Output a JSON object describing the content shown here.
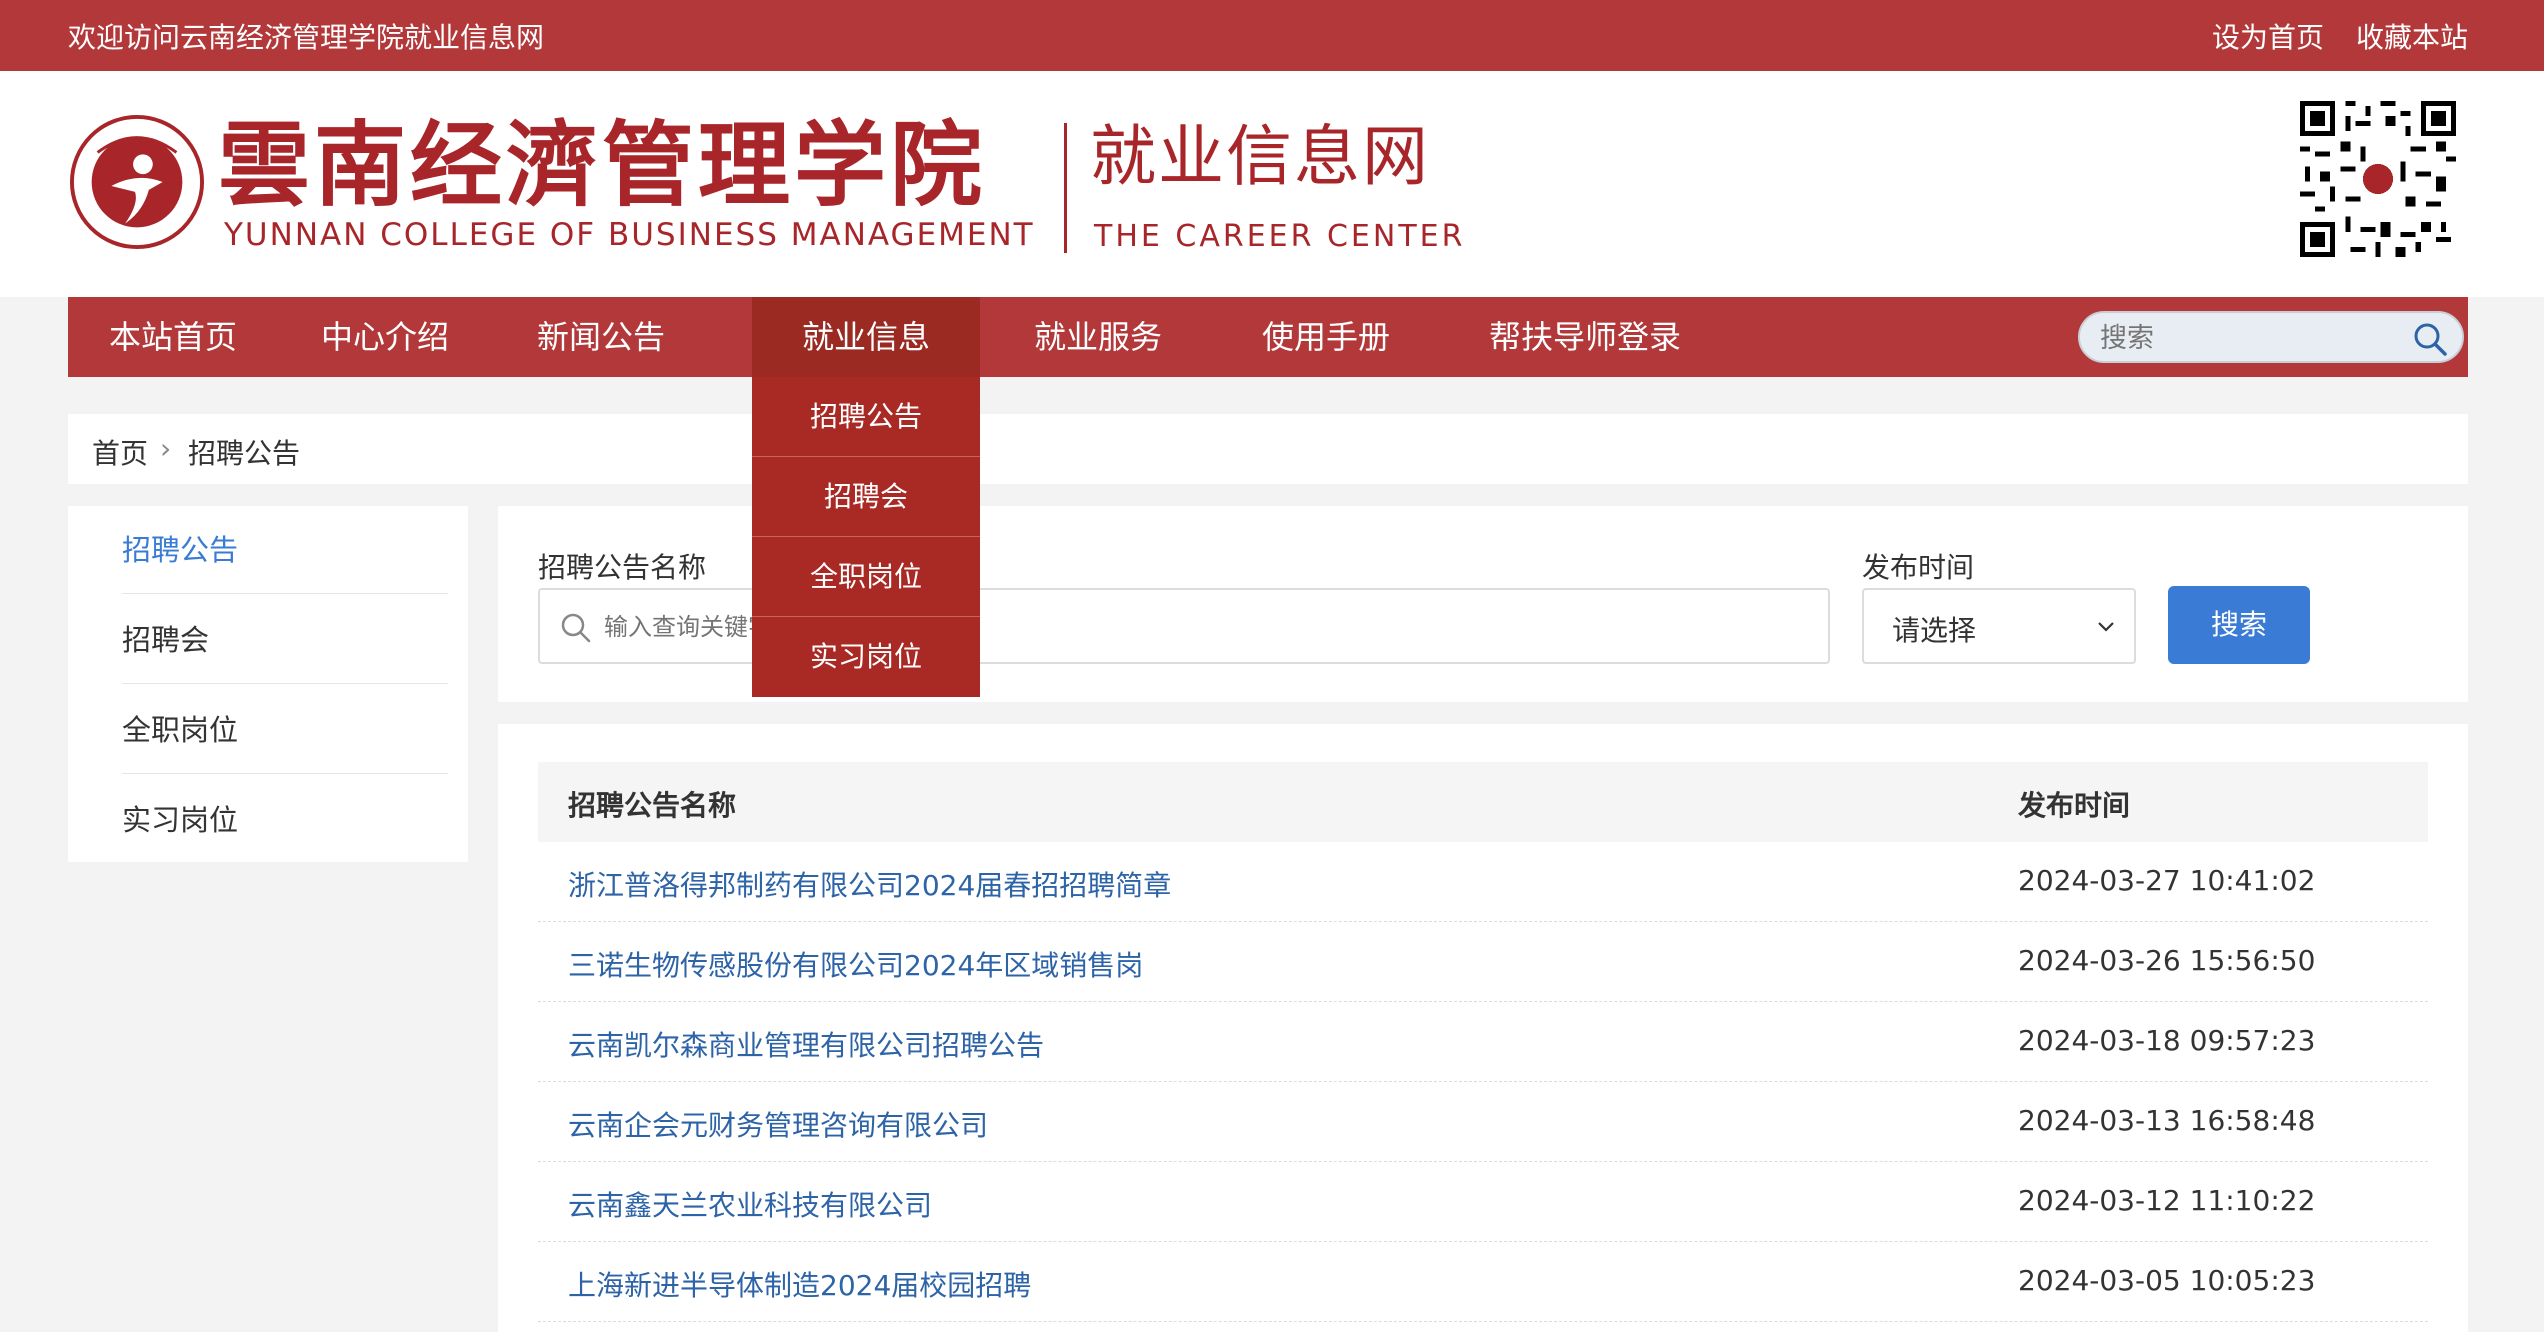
{
  "topbar": {
    "welcome": "欢迎访问云南经济管理学院就业信息网",
    "set_home": "设为首页",
    "bookmark": "收藏本站"
  },
  "header": {
    "college_cn": "雲南经濟管理学院",
    "college_en": "YUNNAN COLLEGE OF BUSINESS MANAGEMENT",
    "site_cn": "就业信息网",
    "site_en": "THE CAREER CENTER"
  },
  "nav": {
    "items": [
      {
        "label": "本站首页"
      },
      {
        "label": "中心介绍"
      },
      {
        "label": "新闻公告"
      },
      {
        "label": "就业信息"
      },
      {
        "label": "就业服务"
      },
      {
        "label": "使用手册"
      },
      {
        "label": "帮扶导师登录"
      }
    ],
    "active_index": 3,
    "search_placeholder": "搜索"
  },
  "dropdown": {
    "items": [
      {
        "label": "招聘公告"
      },
      {
        "label": "招聘会"
      },
      {
        "label": "全职岗位"
      },
      {
        "label": "实习岗位"
      }
    ]
  },
  "breadcrumb": {
    "home": "首页",
    "separator": "›",
    "current": "招聘公告"
  },
  "sidebar": {
    "items": [
      {
        "label": "招聘公告"
      },
      {
        "label": "招聘会"
      },
      {
        "label": "全职岗位"
      },
      {
        "label": "实习岗位"
      }
    ],
    "active_index": 0
  },
  "filter": {
    "name_label": "招聘公告名称",
    "name_placeholder": "输入查询关键字",
    "time_label": "发布时间",
    "time_selected": "请选择",
    "search_button": "搜索"
  },
  "results": {
    "columns": [
      "招聘公告名称",
      "发布时间"
    ],
    "rows": [
      {
        "name": "浙江普洛得邦制药有限公司2024届春招招聘简章",
        "time": "2024-03-27 10:41:02"
      },
      {
        "name": "三诺生物传感股份有限公司2024年区域销售岗",
        "time": "2024-03-26 15:56:50"
      },
      {
        "name": "云南凯尔森商业管理有限公司招聘公告",
        "time": "2024-03-18 09:57:23"
      },
      {
        "name": "云南企会元财务管理咨询有限公司",
        "time": "2024-03-13 16:58:48"
      },
      {
        "name": "云南鑫天兰农业科技有限公司",
        "time": "2024-03-12 11:10:22"
      },
      {
        "name": "上海新进半导体制造2024届校园招聘",
        "time": "2024-03-05 10:05:23"
      }
    ]
  },
  "colors": {
    "brand_red": "#b3383a",
    "dropdown_red": "#a92a25",
    "link_blue": "#2d63a7",
    "button_blue": "#3a7bd5"
  }
}
